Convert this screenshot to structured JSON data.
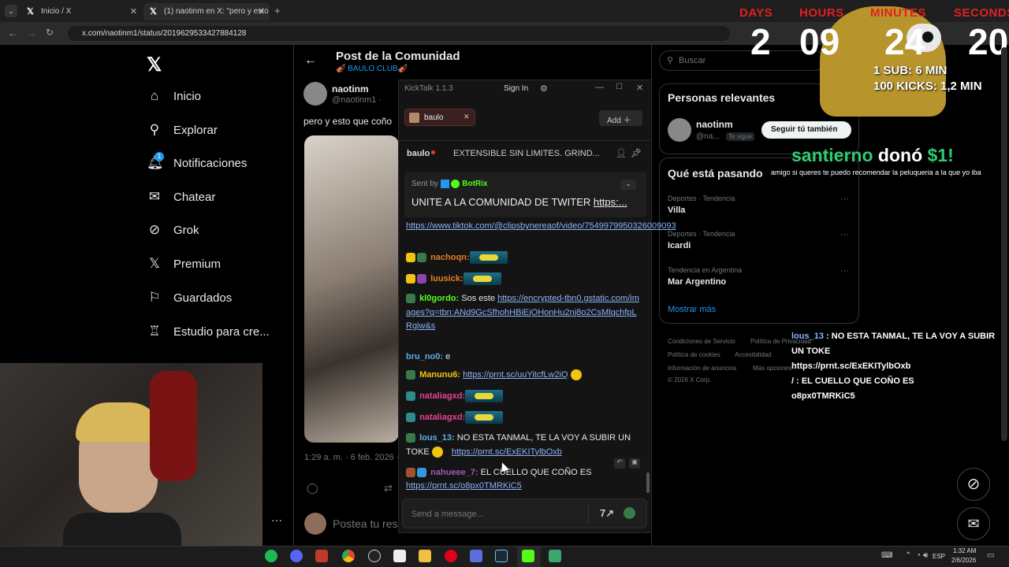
{
  "browser": {
    "tabs": [
      {
        "label": "Inicio / X"
      },
      {
        "label": "(1) naotinm en X: \"pero y esto q..."
      }
    ],
    "url": "x.com/naotinm1/status/2019629533427884128"
  },
  "sidebar": {
    "items": [
      {
        "label": "Inicio",
        "icon": "home-icon"
      },
      {
        "label": "Explorar",
        "icon": "search-icon"
      },
      {
        "label": "Notificaciones",
        "icon": "bell-icon",
        "badge": "1"
      },
      {
        "label": "Chatear",
        "icon": "mail-icon"
      },
      {
        "label": "Grok",
        "icon": "grok-icon"
      },
      {
        "label": "Premium",
        "icon": "x-icon"
      },
      {
        "label": "Guardados",
        "icon": "bookmark-icon"
      },
      {
        "label": "Estudio para cre...",
        "icon": "studio-icon"
      }
    ]
  },
  "post": {
    "header_title": "Post de la Comunidad",
    "community": "🎻 BAULO CLUB🎻",
    "author_name": "naotinm",
    "author_handle": "@naotinm1 ·",
    "text": "pero y esto que coño",
    "timestamp": "1:29 a. m. · 6 feb. 2026 ·",
    "reply_placeholder": "Postea tu res"
  },
  "right": {
    "search_placeholder": "Buscar",
    "relevant_title": "Personas relevantes",
    "person_name": "naotinm",
    "person_handle": "@na...",
    "person_badge": "Te sigue",
    "follow_label": "Seguir tú también",
    "trends_title": "Qué está pasando",
    "trends": [
      {
        "meta": "Deportes · Tendencia",
        "name": "Villa"
      },
      {
        "meta": "Deportes · Tendencia",
        "name": "Icardi"
      },
      {
        "meta": "Tendencia en Argentina",
        "name": "Mar Argentino"
      }
    ],
    "show_more": "Mostrar más",
    "footer": [
      "Condiciones de Servicio",
      "Política de Privacidad",
      "Política de cookies",
      "Accesibilidad",
      "Información de anuncios",
      "Más opciones ···",
      "© 2026 X Corp."
    ]
  },
  "overlay": {
    "labels": [
      "DAYS",
      "HOURS",
      "MINUTES",
      "SECONDS"
    ],
    "values": [
      "2",
      "09",
      "24",
      "20"
    ],
    "sub_rule": "1 SUB: 6 MIN",
    "kick_rule": "100 KICKS: 1,2 MIN",
    "donation_user": "santierno",
    "donation_text": " donó ",
    "donation_amount": "$1!",
    "donation_msg": "amigo si queres te puedo recomendar la peluqueria a la que yo iba",
    "feed": [
      {
        "user": "lous_13",
        "text": " : NO ESTA TANMAL, TE LA VOY A SUBIR UN TOKE"
      },
      {
        "user": "",
        "text": "https://prnt.sc/ExEKITylbOxb"
      },
      {
        "user": "",
        "text": "/ : EL CUELLO QUE COÑO ES"
      },
      {
        "user": "",
        "text": "o8px0TMRKiC5"
      }
    ]
  },
  "kicktalk": {
    "title": "KickTalk 1.1.3",
    "sign_in": "Sign In",
    "channel": "baulo",
    "add_label": "Add",
    "stream_channel": "baulo",
    "stream_title": "EXTENSIBLE SIN LIMITES. GRIND...",
    "pinned_sender_prefix": "Sent by",
    "pinned_sender": "BotRix",
    "pinned_text": "UNITE A LA COMUNIDAD DE TWITER",
    "pinned_link": "https:...",
    "messages": [
      {
        "user": "",
        "text": "",
        "link": "https://www.tiktok.com/@clipsbynereaof/video/7549979950326009093"
      },
      {
        "user": "nachoqn:",
        "text": "",
        "link": ""
      },
      {
        "user": "luusick:",
        "text": "",
        "link": ""
      },
      {
        "user": "kl0gordo:",
        "text": " Sos este ",
        "link": "https://encrypted-tbn0.gstatic.com/images?q=tbn:ANd9GcSfhohHBiEjOHonHu2nj8o2CsMlqchfpLRgiw&s"
      },
      {
        "user": "bru_no0:",
        "text": " e",
        "link": ""
      },
      {
        "user": "Manunu6:",
        "text": " ",
        "link": "https://prnt.sc/uuYitcfLw2iQ"
      },
      {
        "user": "nataliagxd:",
        "text": "",
        "link": ""
      },
      {
        "user": "nataliagxd:",
        "text": "",
        "link": ""
      },
      {
        "user": "lous_13:",
        "text": " NO ESTA TANMAL, TE LA VOY A SUBIR UN TOKE ",
        "link": "https://prnt.sc/ExEKITylbOxb"
      },
      {
        "user": "nahueee_7:",
        "text": " EL CUELLO QUE COÑO ES ",
        "link": "https://prnt.sc/o8px0TMRKiC5"
      }
    ],
    "input_placeholder": "Send a message..."
  },
  "taskbar": {
    "lang": "ESP",
    "time": "1:32 AM",
    "date": "2/6/2026"
  },
  "colors": {
    "kick_green": "#53fc18",
    "timer_red": "#e02020",
    "donation_green": "#2ecc71",
    "x_blue": "#1d9bf0"
  }
}
